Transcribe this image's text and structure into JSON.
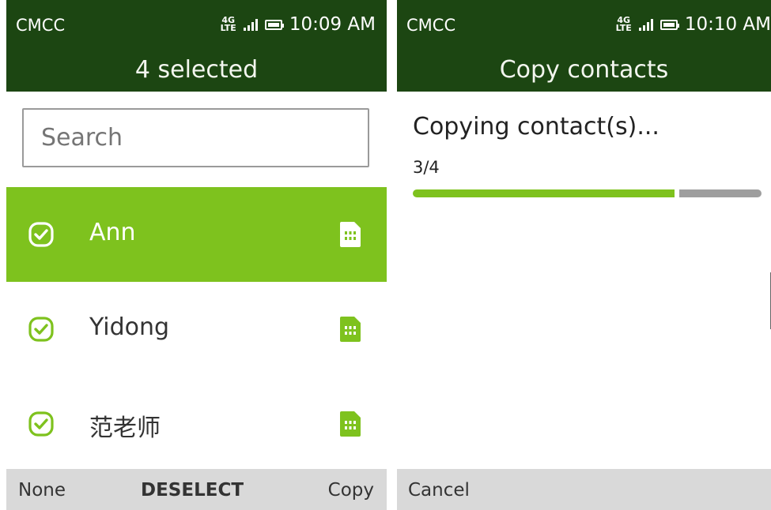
{
  "left_screen": {
    "status": {
      "carrier": "CMCC",
      "network_top": "4G",
      "network_bottom": "LTE",
      "time": "10:09 AM"
    },
    "title": "4 selected",
    "search": {
      "placeholder": "Search",
      "value": ""
    },
    "contacts": [
      {
        "name": "Ann",
        "selected": true,
        "focused": true,
        "icon": "sim-card-icon"
      },
      {
        "name": "Yidong",
        "selected": true,
        "focused": false,
        "icon": "sim-card-icon"
      },
      {
        "name": "范老师",
        "selected": true,
        "focused": false,
        "icon": "sim-card-icon"
      }
    ],
    "softkeys": {
      "left": "None",
      "center": "DESELECT",
      "right": "Copy"
    }
  },
  "right_screen": {
    "status": {
      "carrier": "CMCC",
      "network_top": "4G",
      "network_bottom": "LTE",
      "time": "10:10 AM"
    },
    "title": "Copy contacts",
    "progress": {
      "message": "Copying contact(s)...",
      "count": "3/4",
      "fraction": 0.75
    },
    "softkeys": {
      "left": "Cancel"
    }
  },
  "colors": {
    "header": "#1c4612",
    "accent": "#7ec21e",
    "softkey_bar": "#d9d9d9",
    "progress_rest": "#9e9e9e"
  }
}
